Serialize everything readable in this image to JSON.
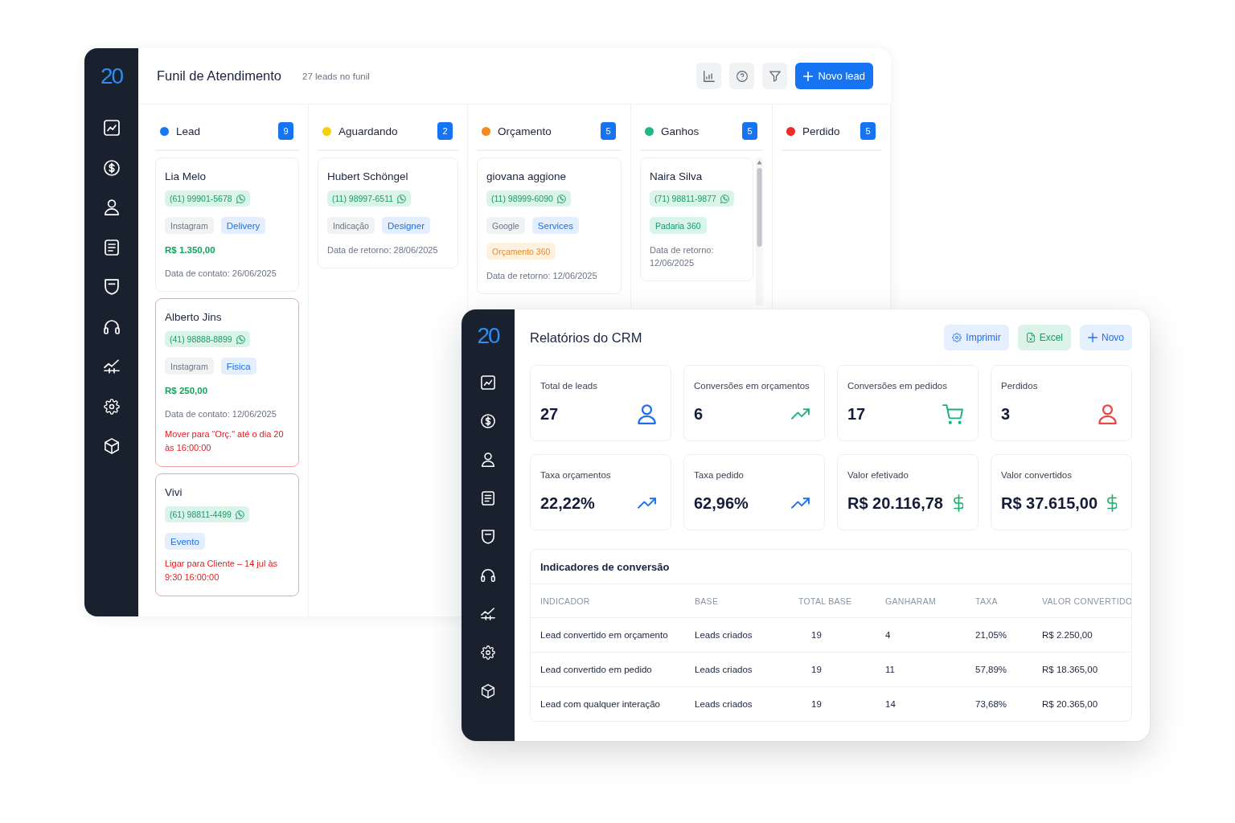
{
  "funnel_window": {
    "logo": "20",
    "title": "Funil de Atendimento",
    "subtitle": "27 leads no funil",
    "new_button": "Novo lead",
    "columns": [
      {
        "name": "Lead",
        "color": "#1877f2",
        "count": "9",
        "scrollable": false,
        "cards": [
          {
            "name": "Lia Melo",
            "phone": "(61) 99901-5678",
            "overdue": false,
            "tags": [
              {
                "text": "Instagram",
                "kind": "source"
              },
              {
                "text": "Delivery",
                "kind": "segment"
              }
            ],
            "value": "R$ 1.350,00",
            "date": "Data de contato: 26/06/2025"
          },
          {
            "name": "Alberto Jins",
            "phone": "(41) 98888-8899",
            "overdue": true,
            "tags": [
              {
                "text": "Instagram",
                "kind": "source"
              },
              {
                "text": "Fisica",
                "kind": "segment"
              }
            ],
            "value": "R$ 250,00",
            "date": "Data de contato: 12/06/2025",
            "alert": "Mover para “Orç.\" até o dia 20 às 16:00:00"
          },
          {
            "name": "Vivi",
            "phone": "(61) 98811-4499",
            "overdue": true,
            "tags": [
              {
                "text": "Evento",
                "kind": "segment"
              }
            ],
            "alert": "Ligar para Cliente – 14 jul às 9:30 16:00:00"
          }
        ]
      },
      {
        "name": "Aguardando",
        "color": "#f5d10a",
        "count": "2",
        "scrollable": false,
        "cards": [
          {
            "name": "Hubert Schöngel",
            "phone": "(11) 98997-6511",
            "overdue": false,
            "tags": [
              {
                "text": "Indicação",
                "kind": "source"
              },
              {
                "text": "Designer",
                "kind": "segment"
              }
            ],
            "date": "Data de retorno: 28/06/2025"
          }
        ]
      },
      {
        "name": "Orçamento",
        "color": "#f7891e",
        "count": "5",
        "scrollable": false,
        "cards": [
          {
            "name": "giovana aggione",
            "phone": "(11) 98999-6090",
            "overdue": false,
            "tags": [
              {
                "text": "Google",
                "kind": "source"
              },
              {
                "text": "Services",
                "kind": "segment"
              },
              {
                "text": "Orçamento 360",
                "kind": "quote"
              }
            ],
            "date": "Data de retorno: 12/06/2025"
          }
        ]
      },
      {
        "name": "Ganhos",
        "color": "#1db980",
        "count": "5",
        "scrollable": true,
        "cards": [
          {
            "name": "Naira Silva",
            "phone": "(71) 98811-9877",
            "overdue": false,
            "tags": [
              {
                "text": "Padaria 360",
                "kind": "company"
              }
            ],
            "date": "Data de retorno: 12/06/2025"
          }
        ]
      },
      {
        "name": "Perdido",
        "color": "#f02a2a",
        "count": "5",
        "scrollable": false
      }
    ]
  },
  "report_window": {
    "logo": "20",
    "title": "Relatórios do CRM",
    "actions": [
      {
        "label": "Imprimir",
        "kind": "print"
      },
      {
        "label": "Excel",
        "kind": "excel"
      },
      {
        "label": "Novo",
        "kind": "new"
      }
    ],
    "stats": [
      {
        "label": "Total de leads",
        "value": "27",
        "kind": "user",
        "color": "#1d6ff2"
      },
      {
        "label": "Conversões em orçamentos",
        "value": "6",
        "kind": "trend",
        "color": "#1fb27a"
      },
      {
        "label": "Conversões em pedidos",
        "value": "17",
        "kind": "cart",
        "color": "#19b078"
      },
      {
        "label": "Perdidos",
        "value": "3",
        "kind": "user",
        "color": "#ef4444"
      },
      {
        "label": "Taxa orçamentos",
        "value": "22,22%",
        "kind": "trend",
        "color": "#1d6ff2"
      },
      {
        "label": "Taxa pedido",
        "value": "62,96%",
        "kind": "trend",
        "color": "#1d6ff2"
      },
      {
        "label": "Valor efetivado",
        "value": "R$ 20.116,78",
        "kind": "dollar",
        "color": "#1fae6b"
      },
      {
        "label": "Valor convertidos",
        "value": "R$ 37.615,00",
        "kind": "dollar",
        "color": "#1fae6b"
      }
    ],
    "table": {
      "title": "Indicadores de conversão",
      "columns": [
        "INDICADOR",
        "BASE",
        "TOTAL BASE",
        "GANHARAM",
        "TAXA",
        "VALOR CONVERTIDO"
      ],
      "rows": [
        [
          "Lead convertido em orçamento",
          "Leads criados",
          "19",
          "4",
          "21,05%",
          "R$ 2.250,00"
        ],
        [
          "Lead convertido em pedido",
          "Leads criados",
          "19",
          "11",
          "57,89%",
          "R$ 18.365,00"
        ],
        [
          "Lead com qualquer interação",
          "Leads criados",
          "19",
          "14",
          "73,68%",
          "R$ 20.365,00"
        ]
      ]
    }
  }
}
